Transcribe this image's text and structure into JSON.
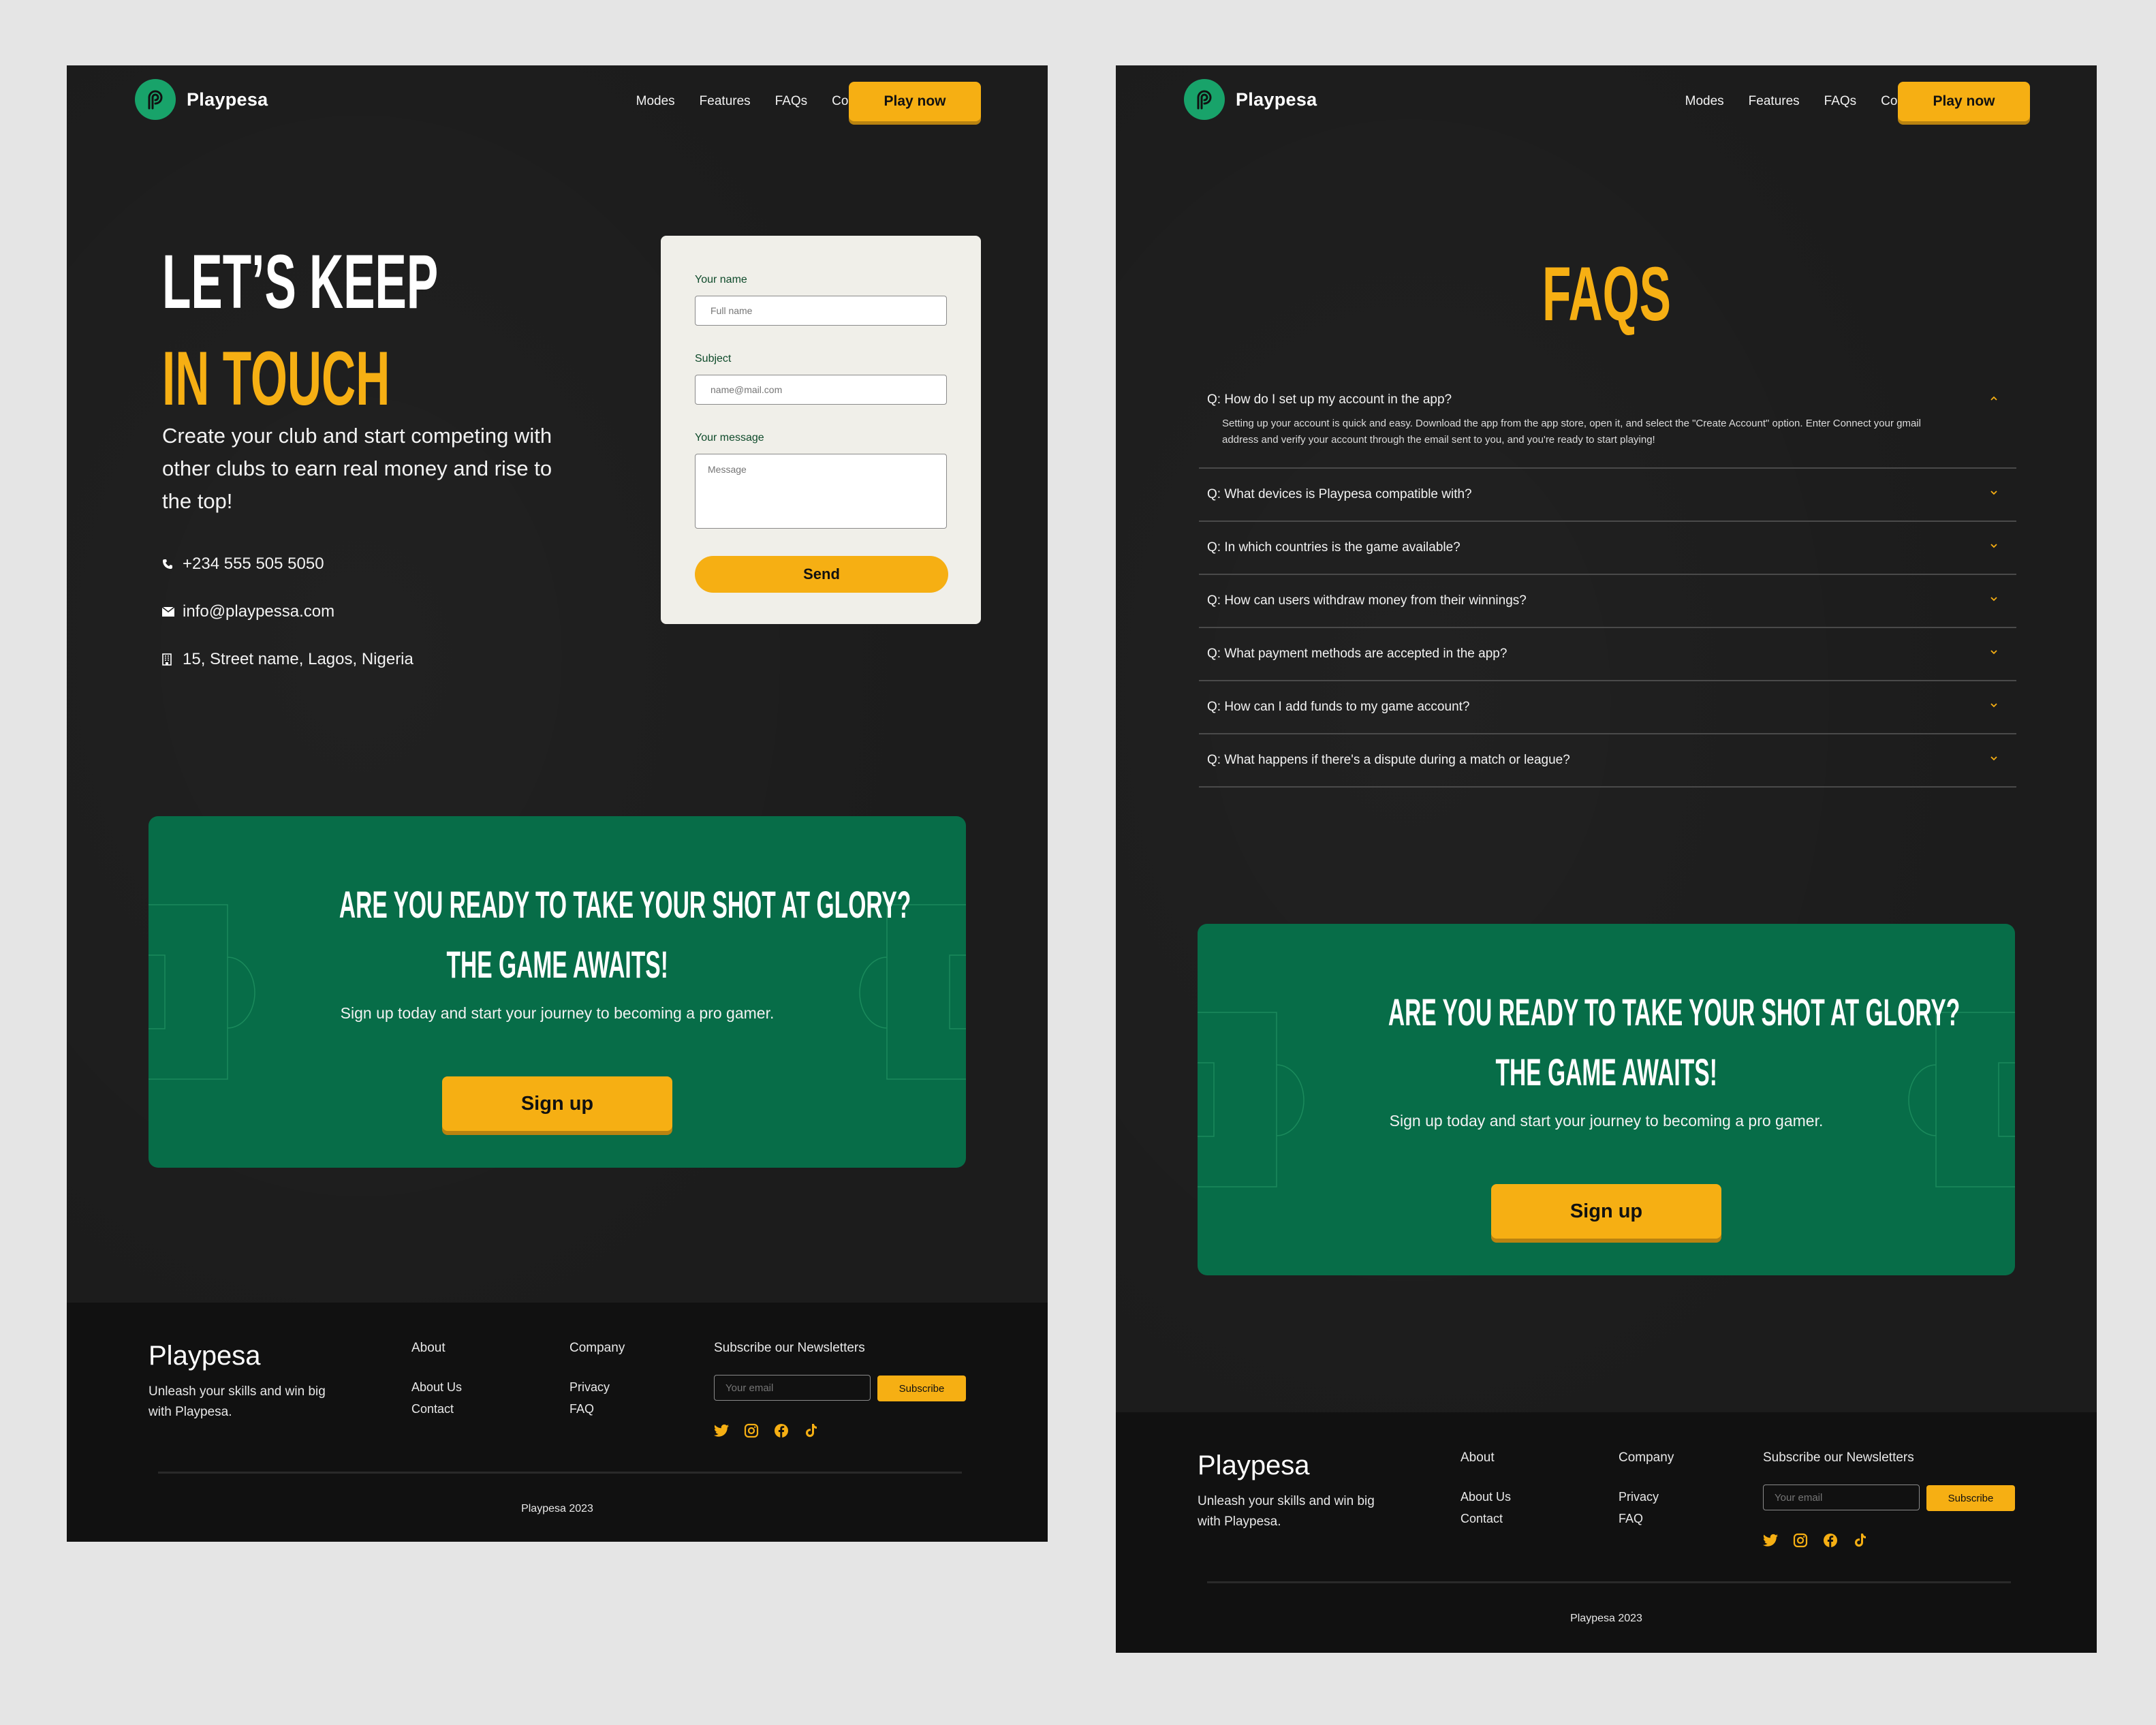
{
  "brand": {
    "name": "Playpesa",
    "accent": "#f6af13",
    "green": "#076d48",
    "logo_green": "#18a36a"
  },
  "nav": {
    "links": [
      "Modes",
      "Features",
      "FAQs",
      "Contact us"
    ],
    "cta": "Play now"
  },
  "contact_page": {
    "heading_line1": "LET’S KEEP",
    "heading_line2": "IN TOUCH",
    "paragraph": "Create your club and start competing with other clubs to earn real money and rise to the top!",
    "contacts": [
      {
        "icon": "phone-icon",
        "text": "+234 555 505 5050"
      },
      {
        "icon": "mail-icon",
        "text": "info@playpessa.com"
      },
      {
        "icon": "building-icon",
        "text": "15, Street name, Lagos, Nigeria"
      }
    ],
    "form": {
      "name_label": "Your name",
      "name_placeholder": "Full name",
      "subject_label": "Subject",
      "subject_placeholder": "name@mail.com",
      "message_label": "Your message",
      "message_placeholder": "Message",
      "send": "Send"
    }
  },
  "faq_page": {
    "title": "FAQS",
    "items": [
      {
        "q": "Q: How do I set up my account in the app?",
        "open": true,
        "a": "Setting up your account is quick and easy. Download the app from the app store, open it, and select the \"Create Account\" option. Enter Connect your gmail address and verify your account through the email sent to you, and you're ready to start playing!"
      },
      {
        "q": "Q: What devices is Playpesa compatible with?",
        "open": false
      },
      {
        "q": "Q: In which countries is the game available?",
        "open": false
      },
      {
        "q": "Q: How can users withdraw money from their winnings?",
        "open": false
      },
      {
        "q": "Q: What payment methods are accepted in the app?",
        "open": false
      },
      {
        "q": "Q: How can I add funds to my game account?",
        "open": false
      },
      {
        "q": "Q: What happens if there's a dispute during a match or league?",
        "open": false
      }
    ]
  },
  "cta": {
    "line1": "ARE YOU READY TO TAKE YOUR SHOT AT GLORY?",
    "line2": "THE GAME AWAITS!",
    "sub": "Sign up today and start your journey to becoming a pro gamer.",
    "button": "Sign up"
  },
  "footer": {
    "brand": "Playpesa",
    "tagline": "Unleash your skills and win big with Playpesa.",
    "about_title": "About",
    "about_links": [
      "About Us",
      "Contact"
    ],
    "company_title": "Company",
    "company_links": [
      "Privacy",
      "FAQ"
    ],
    "newsletter_title": "Subscribe our Newsletters",
    "email_placeholder": "Your email",
    "subscribe": "Subscribe",
    "social": [
      "twitter-icon",
      "instagram-icon",
      "facebook-icon",
      "tiktok-icon"
    ],
    "copyright": "Playpesa 2023"
  }
}
